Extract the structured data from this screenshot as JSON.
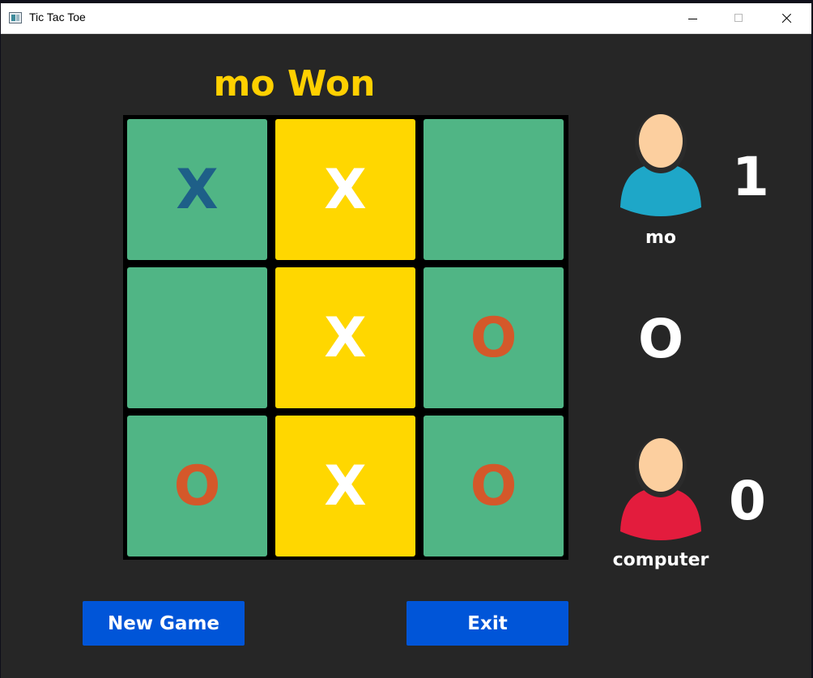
{
  "window": {
    "title": "Tic Tac Toe"
  },
  "status": "mo Won",
  "colors": {
    "background": "#262626",
    "board_border": "#000000",
    "cell": "#50b585",
    "winning_cell": "#ffd700",
    "status_text": "#ffd000",
    "mark_x": "#1e5f88",
    "mark_o": "#d4582a",
    "mark_winning": "#ffffff",
    "button": "#0055d8",
    "player1_shirt": "#1ea7c8",
    "player2_shirt": "#e31c3d",
    "skin": "#fccf9f"
  },
  "board": {
    "cells": [
      {
        "mark": "X",
        "winning": false
      },
      {
        "mark": "X",
        "winning": true
      },
      {
        "mark": "",
        "winning": false
      },
      {
        "mark": "",
        "winning": false
      },
      {
        "mark": "X",
        "winning": true
      },
      {
        "mark": "O",
        "winning": false
      },
      {
        "mark": "O",
        "winning": false
      },
      {
        "mark": "X",
        "winning": true
      },
      {
        "mark": "O",
        "winning": false
      }
    ]
  },
  "players": [
    {
      "name": "mo",
      "score": "1",
      "avatar": "user-avatar-icon-blue"
    },
    {
      "name": "computer",
      "score": "0",
      "avatar": "user-avatar-icon-red"
    }
  ],
  "current_turn": "O",
  "buttons": {
    "new_game": "New Game",
    "exit": "Exit"
  }
}
